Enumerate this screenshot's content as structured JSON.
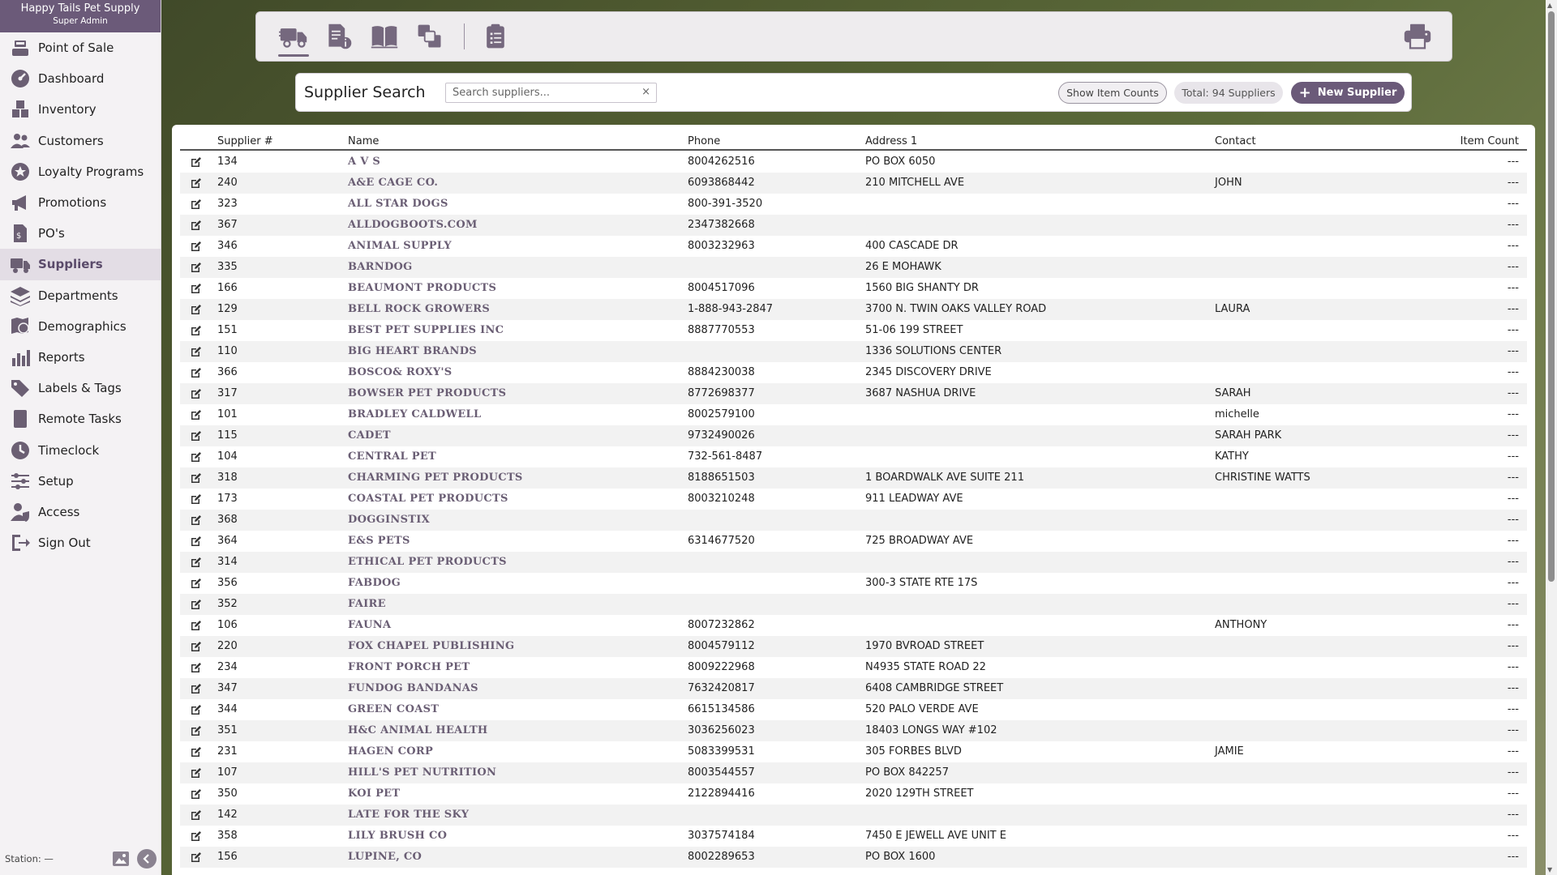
{
  "brand": {
    "name": "Happy Tails Pet Supply",
    "role": "Super Admin"
  },
  "nav": [
    {
      "label": "Point of Sale",
      "icon": "register-icon"
    },
    {
      "label": "Dashboard",
      "icon": "dashboard-icon"
    },
    {
      "label": "Inventory",
      "icon": "boxes-icon"
    },
    {
      "label": "Customers",
      "icon": "customers-icon"
    },
    {
      "label": "Loyalty Programs",
      "icon": "loyalty-icon"
    },
    {
      "label": "Promotions",
      "icon": "megaphone-icon"
    },
    {
      "label": "PO's",
      "icon": "purchase-order-icon"
    },
    {
      "label": "Suppliers",
      "icon": "truck-icon",
      "active": true
    },
    {
      "label": "Departments",
      "icon": "layers-icon"
    },
    {
      "label": "Demographics",
      "icon": "map-pin-icon"
    },
    {
      "label": "Reports",
      "icon": "bar-chart-icon"
    },
    {
      "label": "Labels & Tags",
      "icon": "tags-icon"
    },
    {
      "label": "Remote Tasks",
      "icon": "tablet-icon"
    },
    {
      "label": "Timeclock",
      "icon": "clock-icon"
    },
    {
      "label": "Setup",
      "icon": "sliders-icon"
    },
    {
      "label": "Access",
      "icon": "user-shield-icon"
    },
    {
      "label": "Sign Out",
      "icon": "sign-out-icon"
    }
  ],
  "footer": {
    "station": "Station: —"
  },
  "search": {
    "title": "Supplier Search",
    "placeholder": "Search suppliers...",
    "clear": "×",
    "show_counts": "Show Item Counts",
    "total": "Total: 94 Suppliers",
    "new_supplier": "New Supplier",
    "plus": "+"
  },
  "columns": {
    "num": "Supplier #",
    "name": "Name",
    "phone": "Phone",
    "address": "Address 1",
    "contact": "Contact",
    "count": "Item Count"
  },
  "rows": [
    {
      "num": "134",
      "name": "A V S",
      "phone": "8004262516",
      "address": "PO BOX 6050",
      "contact": "",
      "count": "---"
    },
    {
      "num": "240",
      "name": "A&E CAGE CO.",
      "phone": "6093868442",
      "address": "210 MITCHELL AVE",
      "contact": "JOHN",
      "count": "---"
    },
    {
      "num": "323",
      "name": "ALL STAR DOGS",
      "phone": "800-391-3520",
      "address": "",
      "contact": "",
      "count": "---"
    },
    {
      "num": "367",
      "name": "ALLDOGBOOTS.COM",
      "phone": "2347382668",
      "address": "",
      "contact": "",
      "count": "---"
    },
    {
      "num": "346",
      "name": "ANIMAL SUPPLY",
      "phone": "8003232963",
      "address": "400 CASCADE DR",
      "contact": "",
      "count": "---"
    },
    {
      "num": "335",
      "name": "BARNDOG",
      "phone": "",
      "address": "26 E MOHAWK",
      "contact": "",
      "count": "---"
    },
    {
      "num": "166",
      "name": "BEAUMONT PRODUCTS",
      "phone": "8004517096",
      "address": "1560 BIG SHANTY DR",
      "contact": "",
      "count": "---"
    },
    {
      "num": "129",
      "name": "BELL ROCK GROWERS",
      "phone": "1-888-943-2847",
      "address": "3700 N. TWIN OAKS VALLEY ROAD",
      "contact": "LAURA",
      "count": "---"
    },
    {
      "num": "151",
      "name": "BEST PET SUPPLIES INC",
      "phone": "8887770553",
      "address": "51-06 199 STREET",
      "contact": "",
      "count": "---"
    },
    {
      "num": "110",
      "name": "BIG HEART BRANDS",
      "phone": "",
      "address": "1336 SOLUTIONS CENTER",
      "contact": "",
      "count": "---"
    },
    {
      "num": "366",
      "name": "BOSCO& ROXY'S",
      "phone": "8884230038",
      "address": "2345 DISCOVERY DRIVE",
      "contact": "",
      "count": "---"
    },
    {
      "num": "317",
      "name": "BOWSER PET PRODUCTS",
      "phone": "8772698377",
      "address": "3687 NASHUA DRIVE",
      "contact": "SARAH",
      "count": "---"
    },
    {
      "num": "101",
      "name": "BRADLEY CALDWELL",
      "phone": "8002579100",
      "address": "",
      "contact": "michelle",
      "count": "---"
    },
    {
      "num": "115",
      "name": "CADET",
      "phone": "9732490026",
      "address": "",
      "contact": "SARAH PARK",
      "count": "---"
    },
    {
      "num": "104",
      "name": "CENTRAL PET",
      "phone": "732-561-8487",
      "address": "",
      "contact": "KATHY",
      "count": "---"
    },
    {
      "num": "318",
      "name": "CHARMING PET PRODUCTS",
      "phone": "8188651503",
      "address": "1 BOARDWALK AVE SUITE 211",
      "contact": "CHRISTINE WATTS",
      "count": "---"
    },
    {
      "num": "173",
      "name": "COASTAL PET PRODUCTS",
      "phone": "8003210248",
      "address": "911 LEADWAY AVE",
      "contact": "",
      "count": "---"
    },
    {
      "num": "368",
      "name": "DOGGINSTIX",
      "phone": "",
      "address": "",
      "contact": "",
      "count": "---"
    },
    {
      "num": "364",
      "name": "E&S PETS",
      "phone": "6314677520",
      "address": "725 BROADWAY AVE",
      "contact": "",
      "count": "---"
    },
    {
      "num": "314",
      "name": "ETHICAL PET PRODUCTS",
      "phone": "",
      "address": "",
      "contact": "",
      "count": "---"
    },
    {
      "num": "356",
      "name": "FABDOG",
      "phone": "",
      "address": "300-3 STATE RTE 17S",
      "contact": "",
      "count": "---"
    },
    {
      "num": "352",
      "name": "FAIRE",
      "phone": "",
      "address": "",
      "contact": "",
      "count": "---"
    },
    {
      "num": "106",
      "name": "FAUNA",
      "phone": "8007232862",
      "address": "",
      "contact": "ANTHONY",
      "count": "---"
    },
    {
      "num": "220",
      "name": "FOX CHAPEL PUBLISHING",
      "phone": "8004579112",
      "address": "1970 BVROAD STREET",
      "contact": "",
      "count": "---"
    },
    {
      "num": "234",
      "name": "FRONT PORCH PET",
      "phone": "8009222968",
      "address": "N4935 STATE ROAD 22",
      "contact": "",
      "count": "---"
    },
    {
      "num": "347",
      "name": "FUNDOG BANDANAS",
      "phone": "7632420817",
      "address": "6408 CAMBRIDGE STREET",
      "contact": "",
      "count": "---"
    },
    {
      "num": "344",
      "name": "GREEN COAST",
      "phone": "6615134586",
      "address": "520 PALO VERDE AVE",
      "contact": "",
      "count": "---"
    },
    {
      "num": "351",
      "name": "H&C ANIMAL HEALTH",
      "phone": "3036256023",
      "address": "18403 LONGS WAY #102",
      "contact": "",
      "count": "---"
    },
    {
      "num": "231",
      "name": "HAGEN CORP",
      "phone": "5083399531",
      "address": "305 FORBES BLVD",
      "contact": "JAMIE",
      "count": "---"
    },
    {
      "num": "107",
      "name": "HILL'S PET NUTRITION",
      "phone": "8003544557",
      "address": "PO BOX 842257",
      "contact": "",
      "count": "---"
    },
    {
      "num": "350",
      "name": "KOI PET",
      "phone": "2122894416",
      "address": "2020 129TH STREET",
      "contact": "",
      "count": "---"
    },
    {
      "num": "142",
      "name": "LATE FOR THE SKY",
      "phone": "",
      "address": "",
      "contact": "",
      "count": "---"
    },
    {
      "num": "358",
      "name": "LILY BRUSH CO",
      "phone": "3037574184",
      "address": "7450 E JEWELL AVE UNIT E",
      "contact": "",
      "count": "---"
    },
    {
      "num": "156",
      "name": "LUPINE, CO",
      "phone": "8002289653",
      "address": "PO BOX 1600",
      "contact": "",
      "count": "---"
    }
  ]
}
